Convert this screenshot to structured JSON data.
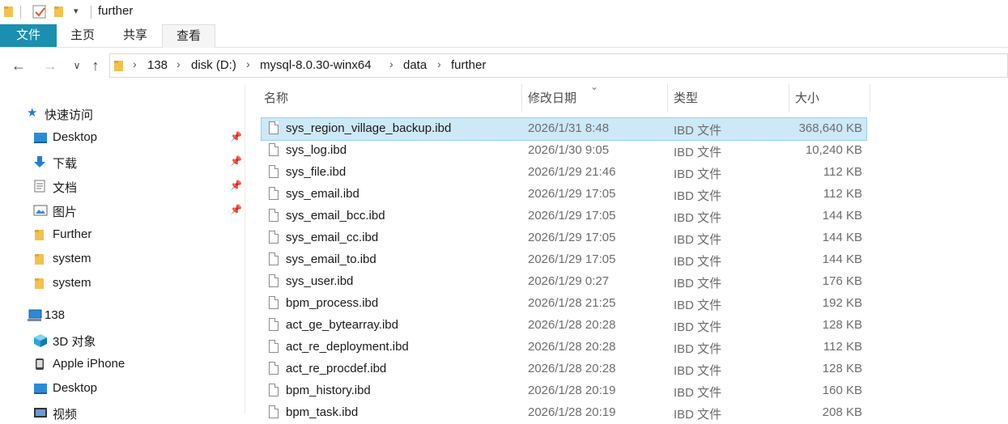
{
  "window": {
    "title": "further"
  },
  "ribbon": {
    "tabs": [
      "文件",
      "主页",
      "共享",
      "查看"
    ]
  },
  "address": {
    "crumbs": [
      "138",
      "disk (D:)",
      "mysql-8.0.30-winx64",
      "data",
      "further"
    ]
  },
  "nav": {
    "quick_access": "快速访问",
    "items": [
      {
        "label": "Desktop",
        "icon": "desktop-icon",
        "pinned": true
      },
      {
        "label": "下载",
        "icon": "download-icon",
        "pinned": true
      },
      {
        "label": "文档",
        "icon": "document-icon",
        "pinned": true
      },
      {
        "label": "图片",
        "icon": "picture-icon",
        "pinned": true
      },
      {
        "label": "Further",
        "icon": "folder-icon",
        "pinned": false
      },
      {
        "label": "system",
        "icon": "folder-icon",
        "pinned": false
      },
      {
        "label": "system",
        "icon": "folder-icon",
        "pinned": false
      }
    ],
    "this_pc": "138",
    "pc_items": [
      {
        "label": "3D 对象",
        "icon": "3d-objects-icon"
      },
      {
        "label": "Apple iPhone",
        "icon": "phone-icon"
      },
      {
        "label": "Desktop",
        "icon": "desktop-icon"
      },
      {
        "label": "视频",
        "icon": "video-icon"
      }
    ]
  },
  "columns": {
    "name": "名称",
    "date": "修改日期",
    "type": "类型",
    "size": "大小"
  },
  "files": [
    {
      "name": "sys_region_village_backup.ibd",
      "date": "2026/1/31 8:48",
      "type": "IBD 文件",
      "size": "368,640 KB"
    },
    {
      "name": "sys_log.ibd",
      "date": "2026/1/30 9:05",
      "type": "IBD 文件",
      "size": "10,240 KB"
    },
    {
      "name": "sys_file.ibd",
      "date": "2026/1/29 21:46",
      "type": "IBD 文件",
      "size": "112 KB"
    },
    {
      "name": "sys_email.ibd",
      "date": "2026/1/29 17:05",
      "type": "IBD 文件",
      "size": "112 KB"
    },
    {
      "name": "sys_email_bcc.ibd",
      "date": "2026/1/29 17:05",
      "type": "IBD 文件",
      "size": "144 KB"
    },
    {
      "name": "sys_email_cc.ibd",
      "date": "2026/1/29 17:05",
      "type": "IBD 文件",
      "size": "144 KB"
    },
    {
      "name": "sys_email_to.ibd",
      "date": "2026/1/29 17:05",
      "type": "IBD 文件",
      "size": "144 KB"
    },
    {
      "name": "sys_user.ibd",
      "date": "2026/1/29 0:27",
      "type": "IBD 文件",
      "size": "176 KB"
    },
    {
      "name": "bpm_process.ibd",
      "date": "2026/1/28 21:25",
      "type": "IBD 文件",
      "size": "192 KB"
    },
    {
      "name": "act_ge_bytearray.ibd",
      "date": "2026/1/28 20:28",
      "type": "IBD 文件",
      "size": "128 KB"
    },
    {
      "name": "act_re_deployment.ibd",
      "date": "2026/1/28 20:28",
      "type": "IBD 文件",
      "size": "112 KB"
    },
    {
      "name": "act_re_procdef.ibd",
      "date": "2026/1/28 20:28",
      "type": "IBD 文件",
      "size": "128 KB"
    },
    {
      "name": "bpm_history.ibd",
      "date": "2026/1/28 20:19",
      "type": "IBD 文件",
      "size": "160 KB"
    },
    {
      "name": "bpm_task.ibd",
      "date": "2026/1/28 20:19",
      "type": "IBD 文件",
      "size": "208 KB"
    }
  ],
  "colors": {
    "accent": "#1a8fb0",
    "selection": "#cde8f7",
    "folder": "#f2c14e"
  }
}
